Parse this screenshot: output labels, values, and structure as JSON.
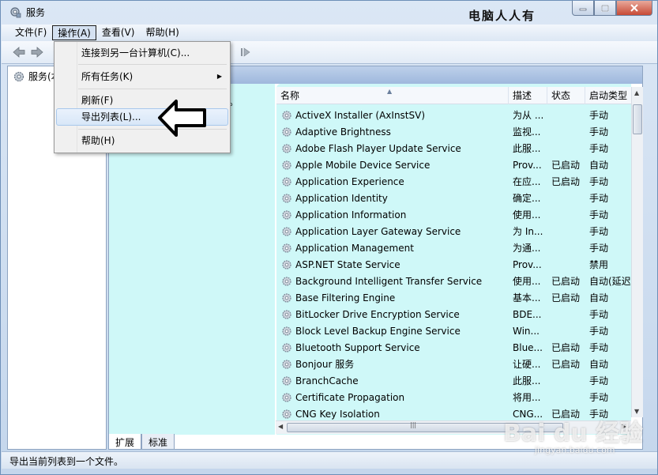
{
  "window": {
    "title": "服务",
    "watermark_text": "电脑人人有"
  },
  "menubar": {
    "items": [
      {
        "id": "file",
        "label": "文件(F)"
      },
      {
        "id": "action",
        "label": "操作(A)"
      },
      {
        "id": "view",
        "label": "查看(V)"
      },
      {
        "id": "help",
        "label": "帮助(H)"
      }
    ]
  },
  "tree": {
    "root_label": "服务(本"
  },
  "dropdown": {
    "connect": "连接到另一台计算机(C)...",
    "all_tasks": "所有任务(K)",
    "refresh": "刷新(F)",
    "export": "导出列表(L)...",
    "help": "帮助(H)"
  },
  "desc_pane": {
    "text_fragment": "述。"
  },
  "list": {
    "columns": {
      "name": "名称",
      "desc": "描述",
      "status": "状态",
      "startup": "启动类型"
    },
    "rows": [
      {
        "name": "ActiveX Installer (AxInstSV)",
        "desc": "为从 ...",
        "status": "",
        "startup": "手动"
      },
      {
        "name": "Adaptive Brightness",
        "desc": "监视...",
        "status": "",
        "startup": "手动"
      },
      {
        "name": "Adobe Flash Player Update Service",
        "desc": "此服...",
        "status": "",
        "startup": "手动"
      },
      {
        "name": "Apple Mobile Device Service",
        "desc": "Prov...",
        "status": "已启动",
        "startup": "自动"
      },
      {
        "name": "Application Experience",
        "desc": "在应...",
        "status": "已启动",
        "startup": "手动"
      },
      {
        "name": "Application Identity",
        "desc": "确定...",
        "status": "",
        "startup": "手动"
      },
      {
        "name": "Application Information",
        "desc": "使用...",
        "status": "",
        "startup": "手动"
      },
      {
        "name": "Application Layer Gateway Service",
        "desc": "为 In...",
        "status": "",
        "startup": "手动"
      },
      {
        "name": "Application Management",
        "desc": "为通...",
        "status": "",
        "startup": "手动"
      },
      {
        "name": "ASP.NET State Service",
        "desc": "Prov...",
        "status": "",
        "startup": "禁用"
      },
      {
        "name": "Background Intelligent Transfer Service",
        "desc": "使用...",
        "status": "已启动",
        "startup": "自动(延迟"
      },
      {
        "name": "Base Filtering Engine",
        "desc": "基本...",
        "status": "已启动",
        "startup": "自动"
      },
      {
        "name": "BitLocker Drive Encryption Service",
        "desc": "BDE...",
        "status": "",
        "startup": "手动"
      },
      {
        "name": "Block Level Backup Engine Service",
        "desc": "Win...",
        "status": "",
        "startup": "手动"
      },
      {
        "name": "Bluetooth Support Service",
        "desc": "Blue...",
        "status": "已启动",
        "startup": "手动"
      },
      {
        "name": "Bonjour 服务",
        "desc": "让硬...",
        "status": "已启动",
        "startup": "自动"
      },
      {
        "name": "BranchCache",
        "desc": "此服...",
        "status": "",
        "startup": "手动"
      },
      {
        "name": "Certificate Propagation",
        "desc": "将用...",
        "status": "",
        "startup": "手动"
      },
      {
        "name": "CNG Key Isolation",
        "desc": "CNG...",
        "status": "已启动",
        "startup": "手动"
      }
    ]
  },
  "tabs": {
    "extended": "扩展",
    "standard": "标准"
  },
  "statusbar": {
    "text": "导出当前列表到一个文件。"
  },
  "watermark": {
    "brand": "Bai du 经验",
    "url": "jingyan.baidu.com"
  },
  "icons": {
    "app": "gear-icon",
    "service": "gear-icon",
    "back": "arrow-left-icon",
    "forward": "arrow-right-icon",
    "play": "play-icon"
  }
}
